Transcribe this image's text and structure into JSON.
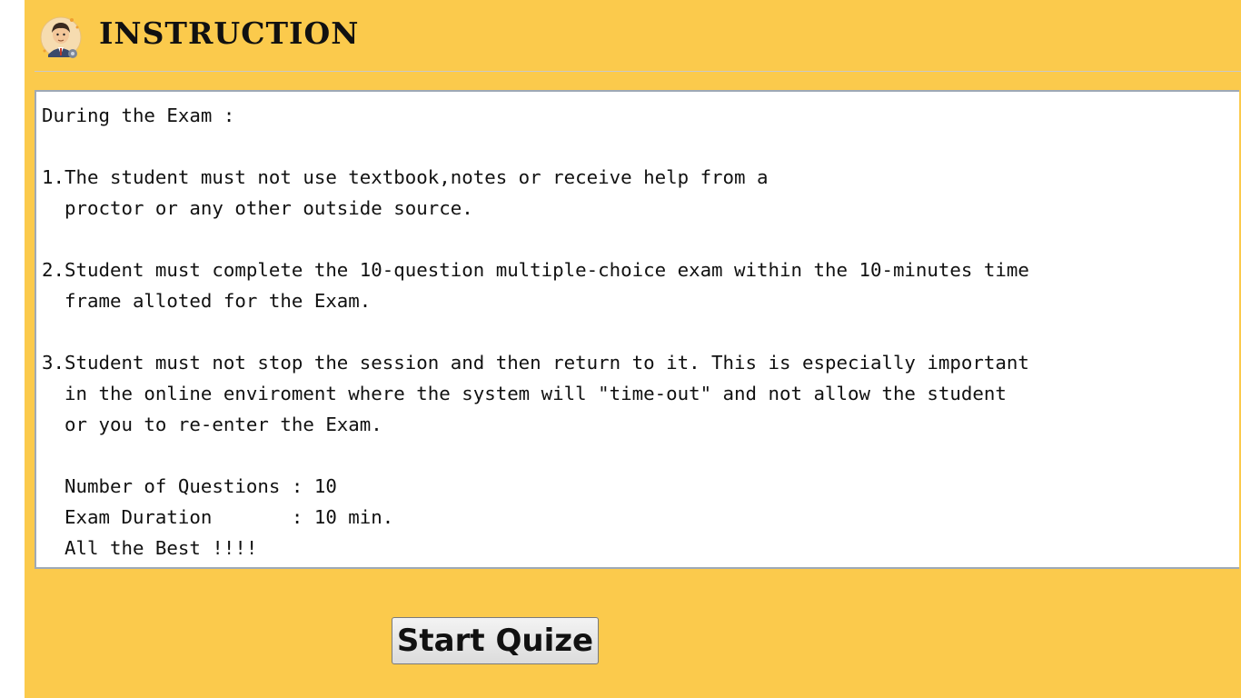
{
  "header": {
    "title": "INSTRUCTION",
    "avatar_icon": "student-avatar-icon"
  },
  "instructions": {
    "text": "During the Exam :\n\n1.The student must not use textbook,notes or receive help from a\n  proctor or any other outside source.\n\n2.Student must complete the 10-question multiple-choice exam within the 10-minutes time\n  frame alloted for the Exam.\n\n3.Student must not stop the session and then return to it. This is especially important\n  in the online enviroment where the system will \"time-out\" and not allow the student\n  or you to re-enter the Exam.\n\n  Number of Questions : 10\n  Exam Duration       : 10 min.\n  All the Best !!!!"
  },
  "actions": {
    "start_label": "Start Quize"
  },
  "colors": {
    "background": "#fbca4c",
    "panel": "#ffffff",
    "panel_border": "#9ea9b6",
    "button_bg": "#e8e8e8"
  }
}
